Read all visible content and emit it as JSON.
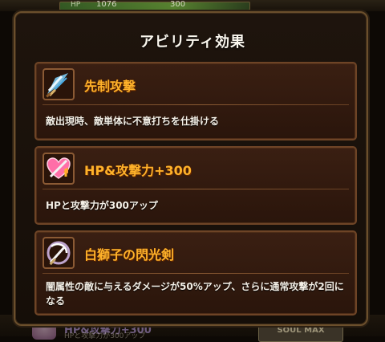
{
  "background": {
    "hp_label": "HP",
    "hp_value": "1076",
    "hp_max": "300",
    "bottom_skill": "HP&攻撃力+300",
    "bottom_sub": "HPと攻撃力が300アップ",
    "soul_max_label": "SOUL MAX"
  },
  "modal": {
    "title": "アビリティ効果",
    "abilities": [
      {
        "name": "先制攻撃",
        "description": "敵出現時、敵単体に不意打ちを仕掛ける",
        "icon": "sword-slash-icon"
      },
      {
        "name": "HP&攻撃力+300",
        "description": "HPと攻撃力が300アップ",
        "icon": "heart-sword-icon"
      },
      {
        "name": "白獅子の閃光剣",
        "description": "闇属性の敵に与えるダメージが50%アップ、さらに通常攻撃が2回になる",
        "icon": "flash-sword-icon"
      }
    ]
  },
  "colors": {
    "card_title": "#ffb22a",
    "modal_border": "#6b4f2c",
    "card_bg": "#3a1f12"
  }
}
